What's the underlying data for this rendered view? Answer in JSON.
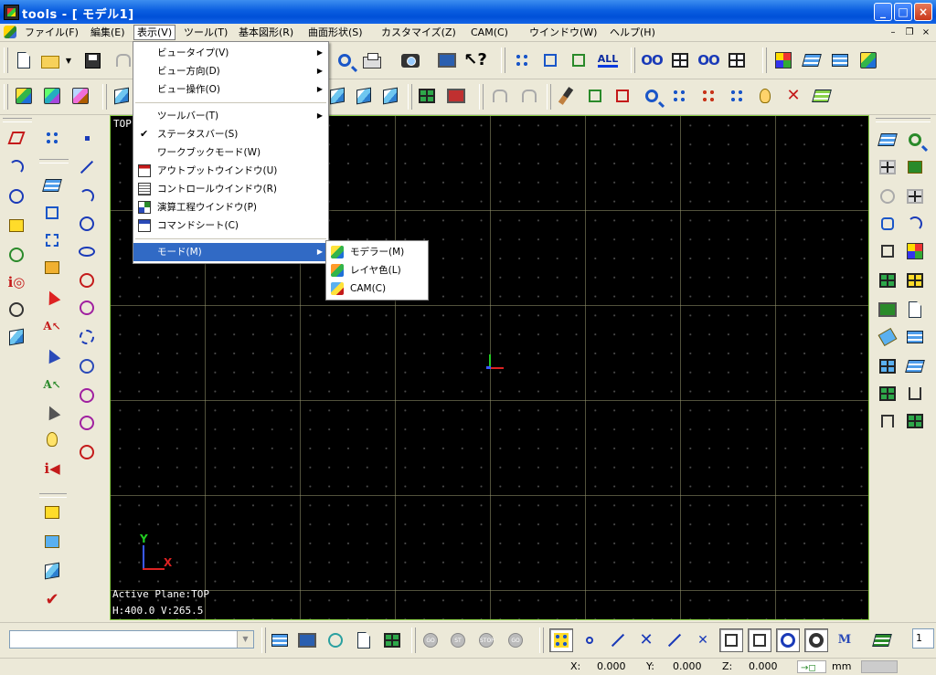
{
  "window": {
    "title": "tools - [ モデル1]",
    "min_label": "_",
    "max_label": "□",
    "close_label": "×"
  },
  "menubar": {
    "items": [
      {
        "label": "ファイル(F)"
      },
      {
        "label": "編集(E)"
      },
      {
        "label": "表示(V)"
      },
      {
        "label": "ツール(T)"
      },
      {
        "label": "基本図形(R)"
      },
      {
        "label": "曲面形状(S)"
      },
      {
        "label": "カスタマイズ(Z)"
      },
      {
        "label": "CAM(C)"
      },
      {
        "label": "ウインドウ(W)"
      },
      {
        "label": "ヘルプ(H)"
      }
    ],
    "mdi_min": "–",
    "mdi_restore": "❐",
    "mdi_close": "×"
  },
  "toolbar": {
    "all_label": "ALL"
  },
  "view_menu": {
    "items": [
      {
        "label": "ビュータイプ(V)",
        "submenu": true
      },
      {
        "label": "ビュー方向(D)",
        "submenu": true
      },
      {
        "label": "ビュー操作(O)",
        "submenu": true
      },
      {
        "label": "ツールバー(T)",
        "submenu": true
      },
      {
        "label": "ステータスバー(S)",
        "checked": true
      },
      {
        "label": "ワークブックモード(W)"
      },
      {
        "label": "アウトプットウインドウ(U)"
      },
      {
        "label": "コントロールウインドウ(R)"
      },
      {
        "label": "演算工程ウインドウ(P)"
      },
      {
        "label": "コマンドシート(C)"
      },
      {
        "label": "モード(M)",
        "submenu": true,
        "highlighted": true
      }
    ],
    "arrow": "▶",
    "check": "✔"
  },
  "mode_submenu": {
    "items": [
      {
        "label": "モデラー(M)"
      },
      {
        "label": "レイヤ色(L)"
      },
      {
        "label": "CAM(C)"
      }
    ]
  },
  "canvas": {
    "view_label": "TOP",
    "active_plane": "Active Plane:TOP",
    "hv_readout": "H:400.0 V:265.5",
    "axis_x": "X",
    "axis_y": "Y"
  },
  "bottom": {
    "command_combo_value": "",
    "combo_arrow": "▼",
    "go_labels": [
      "GO",
      "ST",
      "STOP",
      "GO"
    ],
    "spinner_value": "1"
  },
  "status": {
    "x_label": "X:",
    "x_value": "0.000",
    "y_label": "Y:",
    "y_value": "0.000",
    "z_label": "Z:",
    "z_value": "0.000",
    "unit": "mm"
  },
  "colors": {
    "titlebar": "#0a5ee0",
    "canvas_bg": "#000000",
    "canvas_border": "#8dd14a",
    "grid_line": "#96966e",
    "highlight": "#316ac5"
  }
}
